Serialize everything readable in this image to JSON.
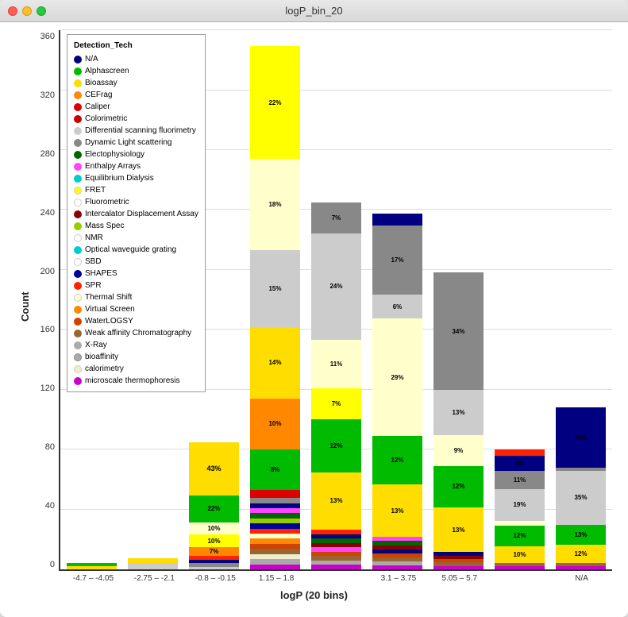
{
  "window": {
    "title": "logP_bin_20"
  },
  "chart": {
    "y_label": "Count",
    "x_label": "logP (20 bins)",
    "y_ticks": [
      "0",
      "40",
      "80",
      "120",
      "160",
      "200",
      "240",
      "280",
      "320",
      "360"
    ],
    "y_max": 360,
    "x_categories": [
      "-4.7 – -4.05",
      "-2.75 – -2.1",
      "-0.8 – -0.15",
      "1.15 – 1.8",
      "3.1 – 3.75",
      "5.05 – 5.7",
      "N/A"
    ]
  },
  "legend": {
    "title": "Detection_Tech",
    "items": [
      {
        "label": "N/A",
        "color": "#000080",
        "shape": "circle"
      },
      {
        "label": "Alphascreen",
        "color": "#00aa00",
        "shape": "circle"
      },
      {
        "label": "Bioassay",
        "color": "#ffdd00",
        "shape": "circle"
      },
      {
        "label": "CEFrag",
        "color": "#ff8800",
        "shape": "circle"
      },
      {
        "label": "Caliper",
        "color": "#cc0000",
        "shape": "circle"
      },
      {
        "label": "Colorimetric",
        "color": "#cc0000",
        "shape": "circle"
      },
      {
        "label": "Differential scanning fluorimetry",
        "color": "#cccccc",
        "shape": "circle"
      },
      {
        "label": "Dynamic Light scattering",
        "color": "#888888",
        "shape": "circle"
      },
      {
        "label": "Electophysiology",
        "color": "#006600",
        "shape": "circle"
      },
      {
        "label": "Enthalpy Arrays",
        "color": "#ff00ff",
        "shape": "circle"
      },
      {
        "label": "Equilibrium Dialysis",
        "color": "#00cccc",
        "shape": "circle"
      },
      {
        "label": "FRET",
        "color": "#ffff00",
        "shape": "circle"
      },
      {
        "label": "Fluorometric",
        "color": "#ffffff",
        "shape": "circle"
      },
      {
        "label": "Intercalator Displacement Assay",
        "color": "#990000",
        "shape": "circle"
      },
      {
        "label": "Mass Spec",
        "color": "#99cc00",
        "shape": "circle"
      },
      {
        "label": "NMR",
        "color": "#ffffff",
        "shape": "circle"
      },
      {
        "label": "Optical waveguide grating",
        "color": "#00cccc",
        "shape": "circle"
      },
      {
        "label": "SBD",
        "color": "#ffffff",
        "shape": "circle"
      },
      {
        "label": "SHAPES",
        "color": "#000099",
        "shape": "circle"
      },
      {
        "label": "SPR",
        "color": "#ff2200",
        "shape": "circle"
      },
      {
        "label": "Thermal Shift",
        "color": "#ffffcc",
        "shape": "circle"
      },
      {
        "label": "Virtual Screen",
        "color": "#ff8800",
        "shape": "circle"
      },
      {
        "label": "WaterLOGSY",
        "color": "#cc4400",
        "shape": "circle"
      },
      {
        "label": "Weak affinity Chromatography",
        "color": "#996633",
        "shape": "circle"
      },
      {
        "label": "X-Ray",
        "color": "#aaaaaa",
        "shape": "circle"
      },
      {
        "label": "bioaffinity",
        "color": "#aaaaaa",
        "shape": "circle"
      },
      {
        "label": "calorimetry",
        "color": "#eeeecc",
        "shape": "circle"
      },
      {
        "label": "microscale thermophoresis",
        "color": "#cc00cc",
        "shape": "circle"
      }
    ]
  }
}
